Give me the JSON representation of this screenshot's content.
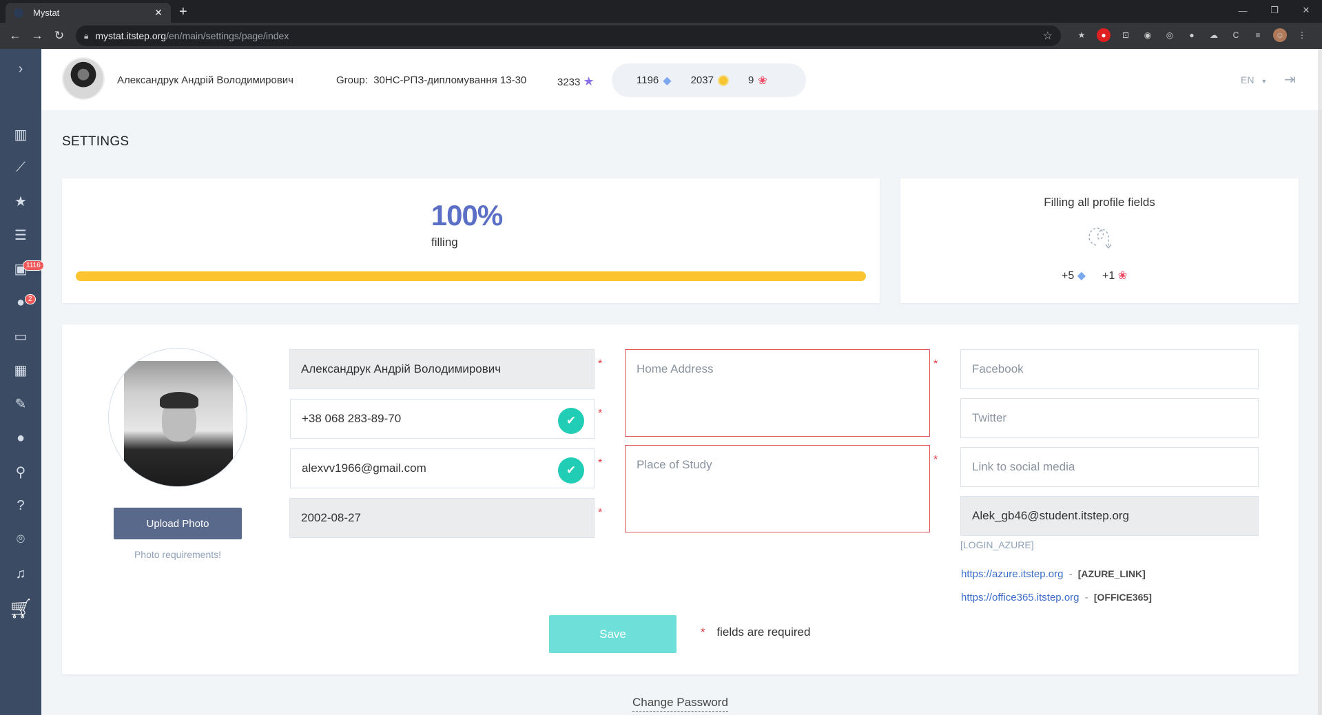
{
  "browser": {
    "tab_title": "Mystat",
    "url_host": "mystat.itstep.org",
    "url_path": "/en/main/settings/page/index"
  },
  "sidebar": {
    "badges": {
      "homework": "1116",
      "messages": "2"
    }
  },
  "header": {
    "user_name": "Александрук Андрій Володимирович",
    "group_label": "Group:",
    "group_value": "30НС-РПЗ-дипломування 13-30",
    "points": "3233",
    "gems": "1196",
    "coins": "2037",
    "awards": "9",
    "language": "EN"
  },
  "page": {
    "title": "SETTINGS"
  },
  "filling": {
    "percent_text": "100%",
    "percent_value": 100,
    "label": "filling"
  },
  "bonus": {
    "title": "Filling all profile fields",
    "gems": "+5",
    "awards": "+1"
  },
  "profile": {
    "upload_label": "Upload Photo",
    "photo_requirements": "Photo requirements!",
    "full_name": "Александрук Андрій Володимирович",
    "phone": "+38 068 283-89-70",
    "email": "alexvv1966@gmail.com",
    "birth_date": "2002-08-27",
    "home_address_placeholder": "Home Address",
    "place_of_study_placeholder": "Place of Study",
    "facebook_placeholder": "Facebook",
    "twitter_placeholder": "Twitter",
    "social_placeholder": "Link to social media",
    "azure_login": "Alek_gb46@student.itstep.org",
    "login_azure_label": "[LOGIN_AZURE]",
    "azure_url": "https://azure.itstep.org",
    "azure_tag": "[AZURE_LINK]",
    "office_url": "https://office365.itstep.org",
    "office_tag": "[OFFICE365]",
    "link_separator": "-"
  },
  "actions": {
    "save_label": "Save",
    "required_star": "*",
    "required_note": "fields are required",
    "change_password": "Change Password"
  },
  "colors": {
    "sidebar": "#3b4b63",
    "accent_percent": "#5a6fc5",
    "progress": "#fcc52f",
    "save": "#6ee0d9",
    "check": "#22cdb6",
    "required": "#e53b45"
  }
}
